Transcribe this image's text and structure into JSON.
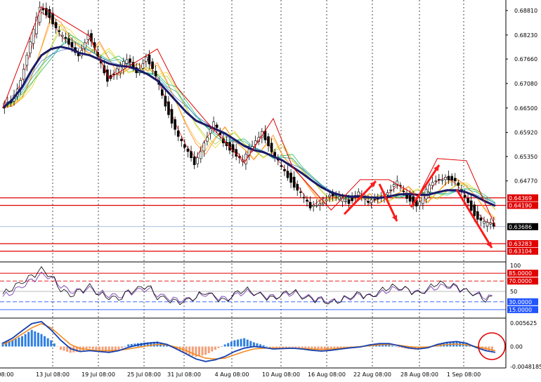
{
  "chart_data": {
    "type": "line",
    "subtype": "candlestick-with-indicators",
    "grid": "vertical dotted lines at date ticks",
    "x_ticks": [
      "08:00",
      "13 Jul 08:00",
      "19 Jul 08:00",
      "25 Jul 08:00",
      "31 Jul 08:00",
      "4 Aug 08:00",
      "10 Aug 08:00",
      "16 Aug 08:00",
      "22 Aug 08:00",
      "28 Aug 08:00",
      "1 Sep 08:00"
    ],
    "price_panel": {
      "y_ticks": [
        "0.68810",
        "0.68230",
        "0.67660",
        "0.67080",
        "0.66500",
        "0.65920",
        "0.65350",
        "0.64770"
      ],
      "ylim": [
        0.6285,
        0.6906
      ],
      "current_price": "0.63686",
      "horizontal_lines": [
        {
          "label": "0.64369",
          "value": 0.64369
        },
        {
          "label": "0.64190",
          "value": 0.6419
        },
        {
          "label": "0.63283",
          "value": 0.63283
        },
        {
          "label": "0.63104",
          "value": 0.63104
        }
      ],
      "close_series": [
        0.665,
        0.6665,
        0.672,
        0.68,
        0.689,
        0.687,
        0.6825,
        0.68,
        0.678,
        0.682,
        0.677,
        0.672,
        0.674,
        0.676,
        0.674,
        0.677,
        0.672,
        0.666,
        0.66,
        0.655,
        0.652,
        0.657,
        0.661,
        0.657,
        0.655,
        0.652,
        0.656,
        0.66,
        0.654,
        0.651,
        0.648,
        0.6445,
        0.641,
        0.643,
        0.644,
        0.6435,
        0.643,
        0.645,
        0.642,
        0.644,
        0.645,
        0.647,
        0.644,
        0.642,
        0.645,
        0.648,
        0.649,
        0.647,
        0.644,
        0.64,
        0.6375,
        0.6369
      ],
      "ma_series": [
        0.665,
        0.667,
        0.67,
        0.674,
        0.6775,
        0.679,
        0.6795,
        0.679,
        0.678,
        0.6775,
        0.6765,
        0.6755,
        0.675,
        0.6748,
        0.674,
        0.673,
        0.6715,
        0.669,
        0.6665,
        0.664,
        0.662,
        0.661,
        0.66,
        0.659,
        0.6575,
        0.656,
        0.655,
        0.6545,
        0.6535,
        0.6525,
        0.651,
        0.6495,
        0.6478,
        0.6462,
        0.645,
        0.6443,
        0.644,
        0.644,
        0.6438,
        0.6437,
        0.644,
        0.6445,
        0.6446,
        0.6444,
        0.6444,
        0.645,
        0.6455,
        0.6455,
        0.645,
        0.644,
        0.6428,
        0.6418
      ]
    },
    "oscillator_panel": {
      "y_ticks": [
        "100",
        "85.0000",
        "70.0000",
        "50",
        "30.0000",
        "15.0000"
      ],
      "ylim": [
        0,
        100
      ],
      "levels": [
        85,
        70,
        50,
        30,
        15
      ],
      "series_a": [
        45,
        58,
        68,
        78,
        92,
        80,
        55,
        42,
        50,
        60,
        45,
        40,
        35,
        48,
        55,
        62,
        40,
        35,
        28,
        32,
        40,
        50,
        38,
        30,
        45,
        55,
        48,
        40,
        35,
        45,
        52,
        40,
        35,
        32,
        28,
        35,
        40,
        45,
        38,
        50,
        60,
        58,
        52,
        45,
        55,
        68,
        62,
        58,
        50,
        45,
        35,
        40
      ],
      "series_b": [
        40,
        50,
        60,
        70,
        82,
        78,
        62,
        50,
        50,
        55,
        48,
        44,
        40,
        46,
        52,
        56,
        45,
        38,
        32,
        34,
        40,
        46,
        40,
        34,
        42,
        50,
        47,
        42,
        38,
        43,
        48,
        42,
        37,
        34,
        31,
        34,
        38,
        42,
        40,
        46,
        54,
        56,
        52,
        47,
        52,
        60,
        60,
        56,
        50,
        46,
        40,
        39
      ]
    },
    "macd_panel": {
      "y_ticks": [
        "0.005625",
        "0.00",
        "-0.0048185"
      ],
      "ylim": [
        -0.0048185,
        0.0065
      ],
      "histogram": [
        0.001,
        0.0015,
        0.0025,
        0.004,
        0.003,
        0.0015,
        -0.0008,
        -0.0015,
        -0.0012,
        -0.0005,
        -0.001,
        -0.0015,
        -0.0008,
        0.0005,
        0.0008,
        0.001,
        0.0012,
        0.0005,
        -0.0008,
        -0.0018,
        -0.0025,
        -0.002,
        -0.0008,
        0.0005,
        0.0015,
        0.002,
        0.001,
        0.0003,
        -0.0005,
        -0.0003,
        -0.0002,
        -0.0004,
        -0.0008,
        -0.001,
        -0.0009,
        -0.0006,
        -0.0003,
        -0.0002,
        0.0004,
        0.0006,
        0.0004,
        -0.0002,
        -0.0006,
        -0.0008,
        -0.0004,
        0.0006,
        0.001,
        0.0012,
        0.0008,
        -0.0004,
        -0.001,
        -0.0012
      ],
      "signal": [
        0.0005,
        0.0015,
        0.003,
        0.0045,
        0.0055,
        0.0045,
        0.0025,
        0.0005,
        -0.0005,
        -0.0008,
        -0.001,
        -0.001,
        -0.0009,
        -0.0006,
        -0.0002,
        0.0002,
        0.0005,
        0.0004,
        -0.0002,
        -0.001,
        -0.002,
        -0.0028,
        -0.003,
        -0.0028,
        -0.002,
        -0.0012,
        -0.0006,
        -0.0004,
        -0.0004,
        -0.0004,
        -0.0004,
        -0.0005,
        -0.0006,
        -0.0007,
        -0.0006,
        -0.0004,
        -0.0002,
        0.0,
        0.0002,
        0.0004,
        0.0005,
        0.0003,
        0.0,
        -0.0002,
        -0.0001,
        0.0002,
        0.0005,
        0.0006,
        0.0004,
        0.0,
        -0.0005,
        -0.001
      ],
      "macd": [
        0.0008,
        0.002,
        0.0038,
        0.0055,
        0.006,
        0.004,
        0.0015,
        -0.0005,
        -0.0012,
        -0.001,
        -0.0012,
        -0.0014,
        -0.001,
        -0.0002,
        0.0004,
        0.0008,
        0.001,
        0.0005,
        -0.0006,
        -0.0018,
        -0.003,
        -0.0036,
        -0.0032,
        -0.0024,
        -0.0012,
        -0.0004,
        0.0,
        -0.0002,
        -0.0006,
        -0.0005,
        -0.0004,
        -0.0006,
        -0.0009,
        -0.0011,
        -0.0009,
        -0.0006,
        -0.0003,
        -0.0001,
        0.0004,
        0.0007,
        0.0007,
        0.0002,
        -0.0003,
        -0.0006,
        -0.0003,
        0.0005,
        0.001,
        0.0012,
        0.0008,
        -0.0002,
        -0.001,
        -0.0014
      ]
    },
    "colors": {
      "candle_up": "#000000",
      "candle_down": "#000000",
      "ma": "#1a1a66",
      "level_line": "#e00000",
      "label_bg": "#e00000",
      "price_label_bg": "#000000",
      "arrow": "#ff1a1a",
      "zigzag": "#e00000",
      "hist_up": "#2f7fe0",
      "hist_down": "#f2a07a",
      "macd_line": "#1540b0",
      "signal_line": "#f08a20",
      "osc_a": "#000000",
      "osc_b": "#7a3fb5",
      "level_30": "#2255ff",
      "level_85": "#e00000",
      "level_70": "#e00000",
      "circle": "#e00000"
    },
    "annotations": [
      "red trend arrows on price panel",
      "red circle around latest MACD values"
    ]
  }
}
